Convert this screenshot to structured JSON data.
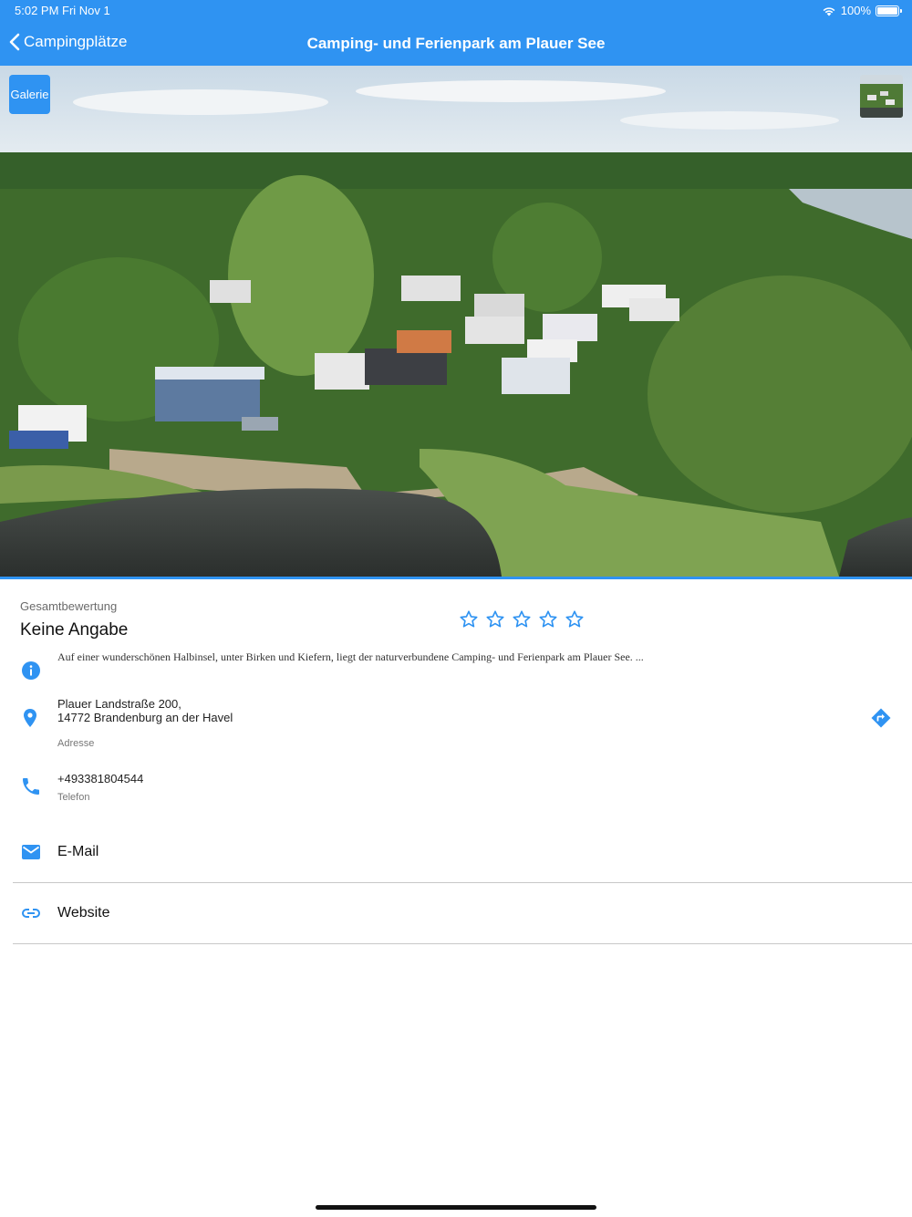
{
  "status_bar": {
    "time": "5:02 PM   Fri Nov 1",
    "battery": "100%"
  },
  "nav": {
    "back_label": "Campingplätze",
    "title": "Camping- und Ferienpark am Plauer See"
  },
  "hero": {
    "gallery_button": "Galerie"
  },
  "rating": {
    "label": "Gesamtbewertung",
    "value": "Keine Angabe",
    "stars_filled": 0,
    "stars_total": 5
  },
  "description": "Auf einer wunderschönen Halbinsel, unter Birken und Kiefern, liegt der naturverbundene Camping- und Ferienpark am Plauer See. ...",
  "address": {
    "line1": "Plauer Landstraße 200,",
    "line2": "14772 Brandenburg an der Havel",
    "label": "Adresse"
  },
  "phone": {
    "number": "+493381804544",
    "label": "Telefon"
  },
  "links": {
    "email": "E-Mail",
    "website": "Website"
  },
  "colors": {
    "accent": "#2f93f2"
  },
  "icons": [
    "chevron-left-icon",
    "wifi-icon",
    "battery-icon",
    "star-outline-icon",
    "info-icon",
    "location-pin-icon",
    "directions-icon",
    "phone-icon",
    "email-icon",
    "link-icon"
  ]
}
